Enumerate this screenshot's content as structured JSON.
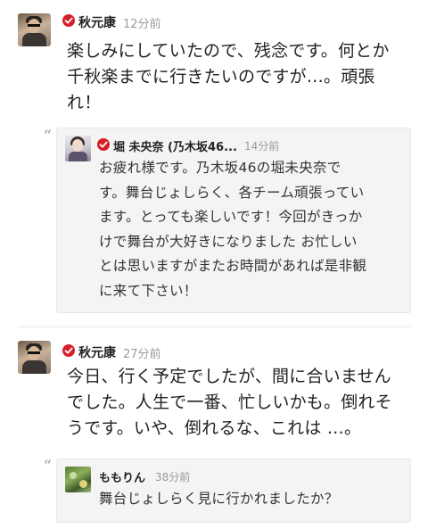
{
  "posts": [
    {
      "author": "秋元康",
      "time": "12分前",
      "text_lines": [
        "楽しみにしていたので、残念です。何とか",
        "千秋楽までに行きたいのですが…。頑張",
        "れ！"
      ],
      "reply": {
        "author": "堀 未央奈 (乃木坂46...",
        "time": "14分前",
        "text_lines": [
          "お疲れ様です。乃木坂46の堀未央奈で",
          "す。舞台じょしらく、各チーム頑張ってい",
          "ます。とっても楽しいです！今回がきっか",
          "けで舞台が大好きになりました お忙しい",
          "とは思いますがまたお時間があれば是非観",
          "に来て下さい！"
        ]
      }
    },
    {
      "author": "秋元康",
      "time": "27分前",
      "text_lines": [
        "今日、行く予定でしたが、間に合いません",
        "でした。人生で一番、忙しいかも。倒れそ",
        "うです。いや、倒れるな、これは …。"
      ],
      "reply": {
        "author": "ももりん",
        "time": "38分前",
        "text_lines": [
          "舞台じょしらく見に行かれましたか？"
        ]
      }
    }
  ],
  "quote_glyph": "“",
  "colors": {
    "verified_badge": "#d5202a",
    "reply_background": "#f4f4f4",
    "timestamp": "#9a9a9a"
  },
  "icons": [
    "verified-badge-icon",
    "quote-icon"
  ]
}
